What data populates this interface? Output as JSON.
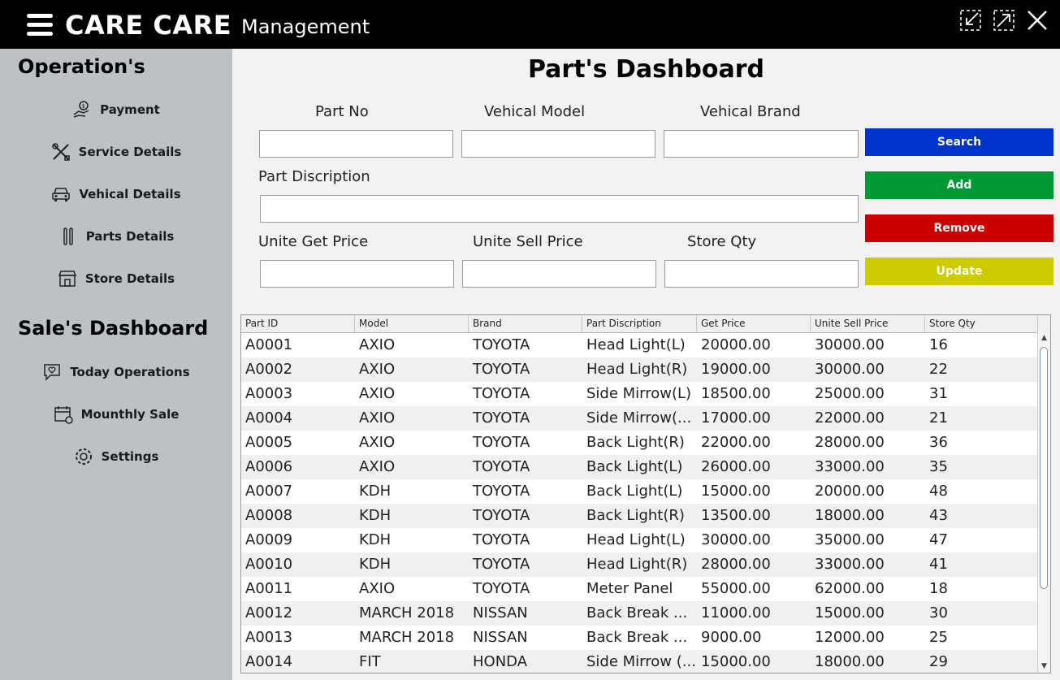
{
  "app": {
    "brand": "CARE CARE",
    "subtitle": "Management"
  },
  "sidebar": {
    "operations_title": "Operation's",
    "operations": [
      {
        "label": "Payment",
        "icon": "payment-hand-icon"
      },
      {
        "label": "Service Details",
        "icon": "tools-icon"
      },
      {
        "label": "Vehical Details",
        "icon": "car-icon"
      },
      {
        "label": "Parts Details",
        "icon": "parts-icon"
      },
      {
        "label": "Store Details",
        "icon": "store-icon"
      }
    ],
    "sales_title": "Sale's Dashboard",
    "sales": [
      {
        "label": "Today Operations",
        "icon": "chat-heart-icon"
      },
      {
        "label": "Mounthly Sale",
        "icon": "calendar-icon"
      },
      {
        "label": "Settings",
        "icon": "gear-icon"
      }
    ]
  },
  "main": {
    "title": "Part's Dashboard",
    "fields": {
      "part_no": {
        "label": "Part No",
        "value": ""
      },
      "vehical_model": {
        "label": "Vehical Model",
        "value": ""
      },
      "vehical_brand": {
        "label": "Vehical Brand",
        "value": ""
      },
      "part_discription": {
        "label": "Part Discription",
        "value": ""
      },
      "unite_get_price": {
        "label": "Unite Get Price",
        "value": ""
      },
      "unite_sell_price": {
        "label": "Unite Sell Price",
        "value": ""
      },
      "store_qty": {
        "label": "Store Qty",
        "value": ""
      }
    },
    "buttons": {
      "search": "Search",
      "add": "Add",
      "remove": "Remove",
      "update": "Update"
    },
    "button_colors": {
      "search": "#0033cc",
      "add": "#009933",
      "remove": "#cc0000",
      "update": "#cccc00"
    }
  },
  "table": {
    "columns": [
      "Part ID",
      "Model",
      "Brand",
      "Part Discription",
      "Get Price",
      "Unite Sell Price",
      "Store Qty"
    ],
    "rows": [
      [
        "A0001",
        "AXIO",
        "TOYOTA",
        "Head Light(L)",
        "20000.00",
        "30000.00",
        "16"
      ],
      [
        "A0002",
        "AXIO",
        "TOYOTA",
        "Head Light(R)",
        "19000.00",
        "30000.00",
        "22"
      ],
      [
        "A0003",
        "AXIO",
        "TOYOTA",
        "Side Mirrow(L)",
        "18500.00",
        "25000.00",
        "31"
      ],
      [
        "A0004",
        "AXIO",
        "TOYOTA",
        "Side Mirrow(...",
        "17000.00",
        "22000.00",
        "21"
      ],
      [
        "A0005",
        "AXIO",
        "TOYOTA",
        "Back Light(R)",
        "22000.00",
        "28000.00",
        "36"
      ],
      [
        "A0006",
        "AXIO",
        "TOYOTA",
        "Back Light(L)",
        "26000.00",
        "33000.00",
        "35"
      ],
      [
        "A0007",
        "KDH",
        "TOYOTA",
        "Back Light(L)",
        "15000.00",
        "20000.00",
        "48"
      ],
      [
        "A0008",
        "KDH",
        "TOYOTA",
        "Back Light(R)",
        "13500.00",
        "18000.00",
        "43"
      ],
      [
        "A0009",
        "KDH",
        "TOYOTA",
        "Head Light(L)",
        "30000.00",
        "35000.00",
        "47"
      ],
      [
        "A0010",
        "KDH",
        "TOYOTA",
        "Head Light(R)",
        "28000.00",
        "33000.00",
        "41"
      ],
      [
        "A0011",
        "AXIO",
        "TOYOTA",
        "Meter Panel",
        "55000.00",
        "62000.00",
        "18"
      ],
      [
        "A0012",
        "MARCH 2018",
        "NISSAN",
        "Back Break ...",
        "11000.00",
        "15000.00",
        "30"
      ],
      [
        "A0013",
        "MARCH 2018",
        "NISSAN",
        "Back Break ...",
        "9000.00",
        "12000.00",
        "25"
      ],
      [
        "A0014",
        "FIT",
        "HONDA",
        "Side Mirrow (...",
        "15000.00",
        "18000.00",
        "29"
      ]
    ]
  }
}
